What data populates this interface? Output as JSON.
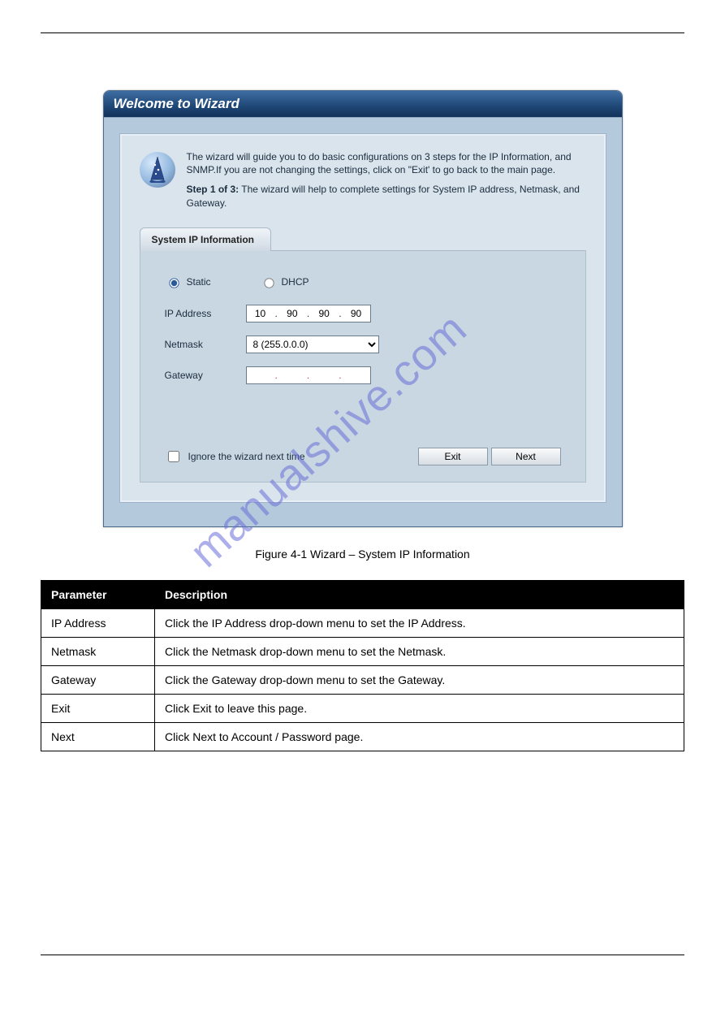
{
  "wizard": {
    "title": "Welcome to Wizard",
    "intro1": "The wizard will guide you to do basic configurations on 3 steps for the IP Information, and SNMP.If you are not changing the settings, click on \"Exit' to go back to the main page.",
    "step_label": "Step 1 of 3:",
    "step_text": " The wizard will help to complete settings for System IP address, Netmask, and Gateway."
  },
  "tab": {
    "label": "System IP Information"
  },
  "mode": {
    "static": "Static",
    "dhcp": "DHCP"
  },
  "labels": {
    "ip": "IP Address",
    "netmask": "Netmask",
    "gateway": "Gateway"
  },
  "ip": {
    "o1": "10",
    "o2": "90",
    "o3": "90",
    "o4": "90"
  },
  "netmask": {
    "value": "8 (255.0.0.0)"
  },
  "gateway": {
    "o1": "",
    "o2": "",
    "o3": "",
    "o4": ""
  },
  "actions": {
    "ignore": "Ignore the wizard next time",
    "exit": "Exit",
    "next": "Next"
  },
  "figure_caption": "Figure 4-1 Wizard – System IP Information",
  "table": {
    "header_param": "Parameter",
    "header_desc": "Description",
    "rows": [
      {
        "param": "IP Address",
        "desc": "Click the IP Address drop-down menu to set the IP Address."
      },
      {
        "param": "Netmask",
        "desc": "Click the Netmask drop-down menu to set the Netmask."
      },
      {
        "param": "Gateway",
        "desc": "Click the Gateway drop-down menu to set the Gateway."
      },
      {
        "param": "Exit",
        "desc": "Click Exit to leave this page."
      },
      {
        "param": "Next",
        "desc": "Click Next to Account / Password page."
      }
    ]
  },
  "watermark": "manualshive.com"
}
